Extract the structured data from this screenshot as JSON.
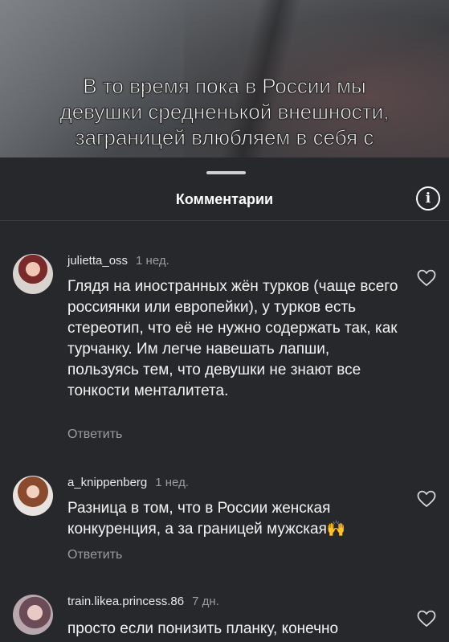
{
  "video": {
    "overlay_lines": [
      "В то время пока в России мы",
      "девушки средненькой внешности,",
      "заграницей влюбляем в себя с"
    ]
  },
  "sheet": {
    "title": "Комментарии",
    "info_icon": "info-icon"
  },
  "comments": [
    {
      "username": "julietta_oss",
      "time": "1 нед.",
      "text": "Глядя на иностранных жён турков (чаще всего россиянки или европейки), у турков есть стереотип, что её не нужно содержать так, как турчанку. Им легче навешать лапши, пользуясь тем, что девушки не знают все тонкости менталитета.",
      "reply_label": "Ответить"
    },
    {
      "username": "a_knippenberg",
      "time": "1 нед.",
      "text": "Разница в том, что в России женская конкуренция, а за границей мужская🙌",
      "reply_label": "Ответить"
    },
    {
      "username": "train.likea.princess.86",
      "time": "7 дн.",
      "text": "просто если понизить планку, конечно"
    }
  ],
  "colors": {
    "background": "#26282b",
    "muted_text": "#9a9ca0"
  }
}
